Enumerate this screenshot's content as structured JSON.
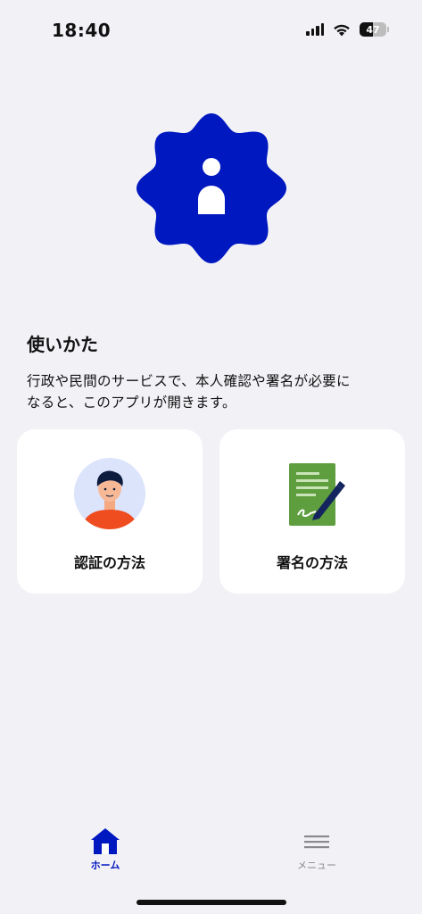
{
  "status_bar": {
    "time": "18:40",
    "battery": "47"
  },
  "colors": {
    "accent": "#0018c0",
    "background": "#f2f1f6",
    "card": "#ffffff",
    "inactive": "#8a8a8e"
  },
  "hero": {
    "icon": "info-badge-icon"
  },
  "usage": {
    "title": "使いかた",
    "description_line1": "行政や民間のサービスで、本人確認や署名が必要に",
    "description_line2": "なると、このアプリが開きます。"
  },
  "cards": [
    {
      "label": "認証の方法",
      "icon": "person-avatar-icon"
    },
    {
      "label": "署名の方法",
      "icon": "signature-document-icon"
    }
  ],
  "tab_bar": {
    "home_label": "ホーム",
    "menu_label": "メニュー",
    "active": "home"
  }
}
